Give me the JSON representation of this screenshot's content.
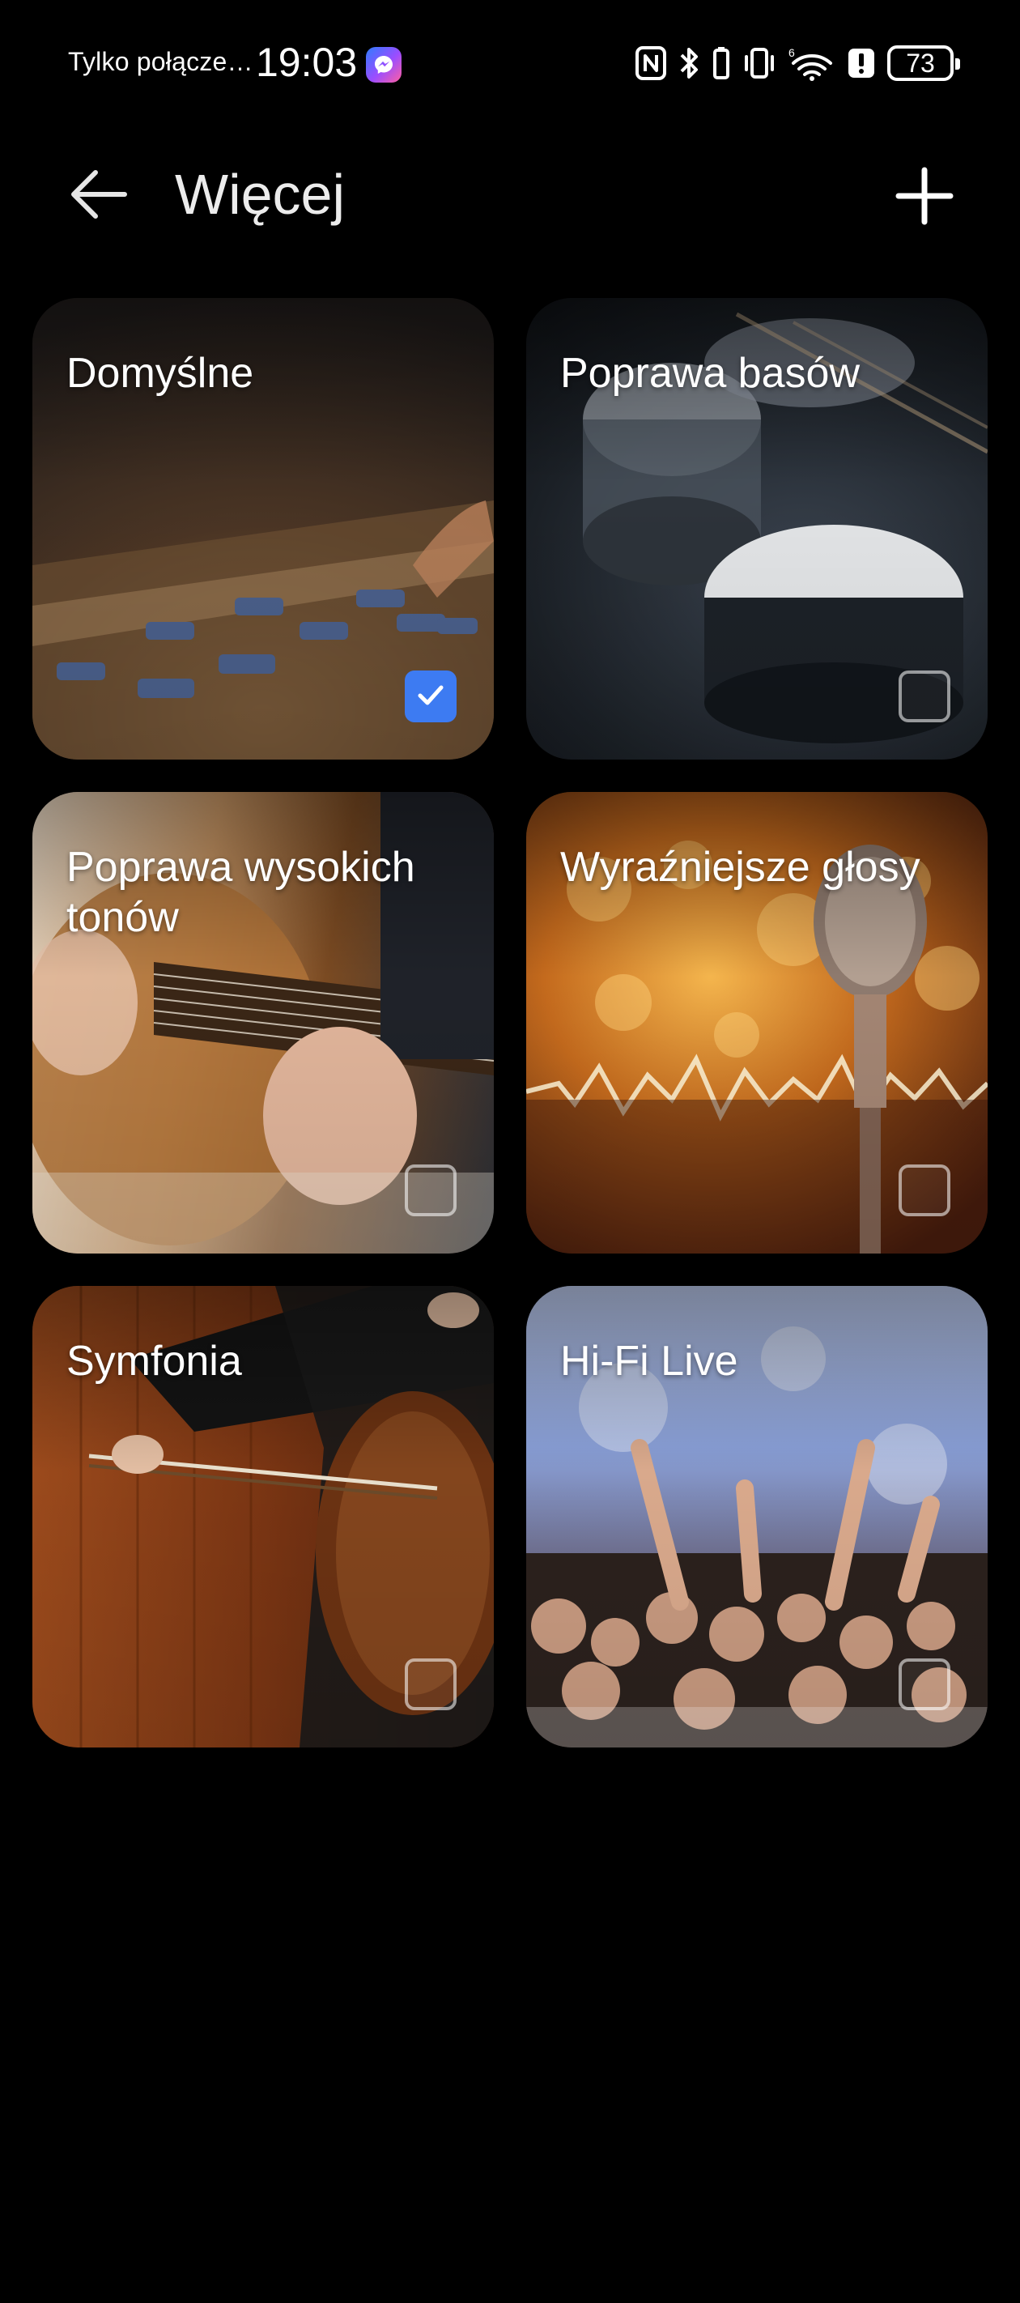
{
  "status_bar": {
    "carrier": "Tylko połącze…",
    "time": "19:03",
    "battery": "73",
    "messenger_icon": "messenger-icon",
    "icons": [
      "nfc-icon",
      "bluetooth-icon",
      "vibrate-icon",
      "wifi-icon",
      "alert-icon",
      "battery-icon"
    ]
  },
  "header": {
    "title": "Więcej",
    "back_icon": "back-arrow-icon",
    "add_icon": "plus-icon"
  },
  "presets": [
    {
      "label": "Domyślne",
      "checked": true,
      "art": "mixer"
    },
    {
      "label": "Poprawa basów",
      "checked": false,
      "art": "drums"
    },
    {
      "label": "Poprawa wysokich tonów",
      "checked": false,
      "art": "guitar"
    },
    {
      "label": "Wyraźniejsze głosy",
      "checked": false,
      "art": "microphone"
    },
    {
      "label": "Symfonia",
      "checked": false,
      "art": "cello"
    },
    {
      "label": "Hi-Fi Live",
      "checked": false,
      "art": "concert"
    }
  ],
  "colors": {
    "background": "#000000",
    "accent_check": "#3d7bf2",
    "text": "#ffffff"
  }
}
